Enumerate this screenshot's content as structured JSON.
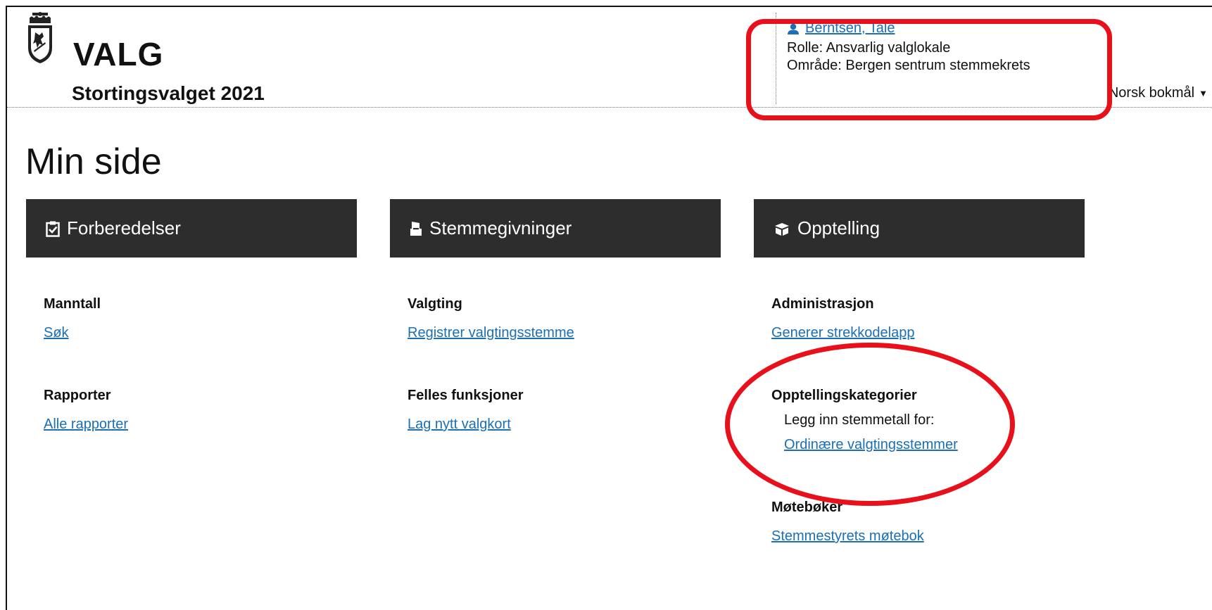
{
  "header": {
    "brand": "VALG",
    "election": "Stortingsvalget 2021",
    "user": {
      "name": "Berntsen, Tale",
      "role": "Rolle: Ansvarlig valglokale",
      "area": "Område: Bergen sentrum stemmekrets"
    },
    "language": "Norsk bokmål"
  },
  "page": {
    "title": "Min side"
  },
  "panels": [
    {
      "title": "Forberedelser",
      "sections": [
        {
          "title": "Manntall",
          "links": [
            "Søk"
          ]
        },
        {
          "title": "Rapporter",
          "links": [
            "Alle rapporter"
          ]
        }
      ]
    },
    {
      "title": "Stemmegivninger",
      "sections": [
        {
          "title": "Valgting",
          "links": [
            "Registrer valgtingsstemme"
          ]
        },
        {
          "title": "Felles funksjoner",
          "links": [
            "Lag nytt valgkort"
          ]
        }
      ]
    },
    {
      "title": "Opptelling",
      "sections": [
        {
          "title": "Administrasjon",
          "links": [
            "Generer strekkodelapp"
          ]
        },
        {
          "title": "Opptellingskategorier",
          "text": "Legg inn stemmetall for:",
          "links": [
            "Ordinære valgtingsstemmer"
          ]
        },
        {
          "title": "Møtebøker",
          "links": [
            "Stemmestyrets møtebok"
          ]
        }
      ]
    }
  ],
  "colors": {
    "link": "#1a6fb6",
    "panel_header": "#2d2d2d",
    "annotation": "#e8101b"
  }
}
